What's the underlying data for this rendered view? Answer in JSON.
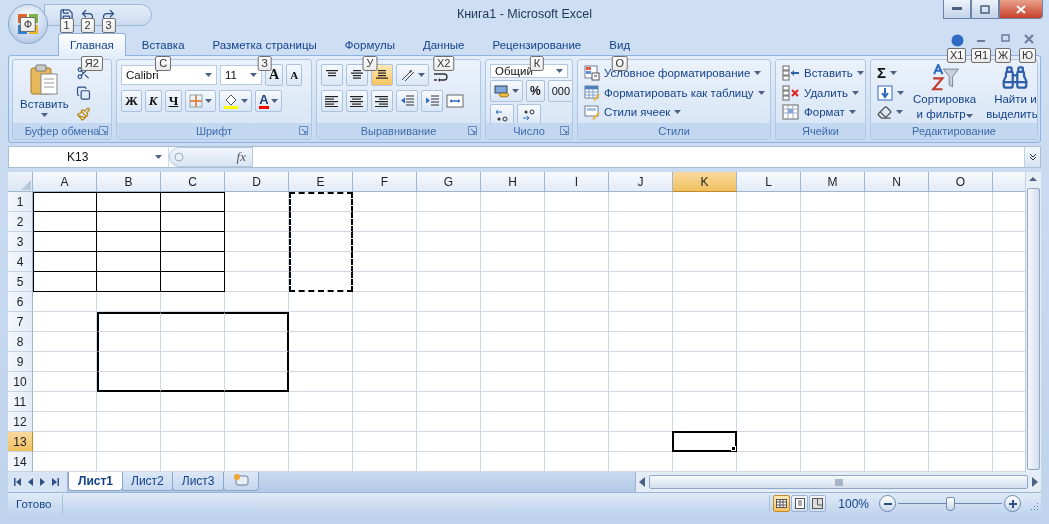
{
  "window": {
    "title": "Книга1 - Microsoft Excel"
  },
  "office_button": {
    "keytip": "Ф"
  },
  "quick_access": [
    {
      "kind": "save",
      "keytip": "1"
    },
    {
      "kind": "undo",
      "keytip": "2"
    },
    {
      "kind": "redo",
      "keytip": "3"
    }
  ],
  "tabs": [
    {
      "label": "Главная",
      "selected": true,
      "keytip": "Я2"
    },
    {
      "label": "Вставка",
      "selected": false,
      "keytip": "С"
    },
    {
      "label": "Разметка страницы",
      "selected": false,
      "keytip": "З"
    },
    {
      "label": "Формулы",
      "selected": false,
      "keytip": "У"
    },
    {
      "label": "Данные",
      "selected": false,
      "keytip": "Х2"
    },
    {
      "label": "Рецензирование",
      "selected": false,
      "keytip": "К"
    },
    {
      "label": "Вид",
      "selected": false,
      "keytip": "О"
    }
  ],
  "workbook_controls": [
    {
      "kind": "help",
      "keytip": "Х1"
    },
    {
      "kind": "minimize",
      "keytip": "Я1"
    },
    {
      "kind": "restore",
      "keytip": "Ж"
    },
    {
      "kind": "close",
      "keytip": "Ю"
    }
  ],
  "ribbon": {
    "clipboard": {
      "label": "Буфер обмена",
      "launcher": true,
      "paste": "Вставить"
    },
    "font": {
      "label": "Шрифт",
      "launcher": true,
      "font_name": "Calibri",
      "font_size": "11",
      "grow": "A",
      "shrink": "A",
      "bold": "Ж",
      "italic": "К",
      "underline": "Ч",
      "font_color": "A"
    },
    "alignment": {
      "label": "Выравнивание",
      "launcher": true,
      "vertical": [
        {
          "kind": "top",
          "selected": false
        },
        {
          "kind": "middle",
          "selected": false
        },
        {
          "kind": "bottom",
          "selected": true
        }
      ],
      "horizontal": [
        {
          "kind": "left",
          "selected": false
        },
        {
          "kind": "center",
          "selected": false
        },
        {
          "kind": "right",
          "selected": false
        }
      ]
    },
    "number": {
      "label": "Число",
      "launcher": true,
      "format": "Общий",
      "percent": "%",
      "thousands": "000"
    },
    "styles": {
      "label": "Стили",
      "launcher": false,
      "items": [
        {
          "kind": "conditional",
          "label": "Условное форматирование"
        },
        {
          "kind": "table",
          "label": "Форматировать как таблицу"
        },
        {
          "kind": "cell-styles",
          "label": "Стили ячеек"
        }
      ]
    },
    "cells": {
      "label": "Ячейки",
      "launcher": false,
      "items": [
        {
          "kind": "insert",
          "label": "Вставить"
        },
        {
          "kind": "delete",
          "label": "Удалить"
        },
        {
          "kind": "format",
          "label": "Формат"
        }
      ]
    },
    "editing": {
      "label": "Редактирование",
      "launcher": false,
      "autosum": "Σ",
      "sort": [
        "Сортировка",
        "и фильтр"
      ],
      "find": [
        "Найти и",
        "выделить"
      ]
    }
  },
  "formula_bar": {
    "name_box": "K13",
    "function_label": "fx"
  },
  "columns": [
    {
      "label": "A",
      "selected": false
    },
    {
      "label": "B",
      "selected": false
    },
    {
      "label": "C",
      "selected": false
    },
    {
      "label": "D",
      "selected": false
    },
    {
      "label": "E",
      "selected": false
    },
    {
      "label": "F",
      "selected": false
    },
    {
      "label": "G",
      "selected": false
    },
    {
      "label": "H",
      "selected": false
    },
    {
      "label": "I",
      "selected": false
    },
    {
      "label": "J",
      "selected": false
    },
    {
      "label": "K",
      "selected": true
    },
    {
      "label": "L",
      "selected": false
    },
    {
      "label": "M",
      "selected": false
    },
    {
      "label": "N",
      "selected": false
    },
    {
      "label": "O",
      "selected": false
    }
  ],
  "rows": [
    {
      "label": "1",
      "selected": false,
      "cells": [
        {
          "kind": "thin"
        },
        {
          "kind": "thin"
        },
        {
          "kind": "thin"
        },
        {
          "kind": "plain"
        },
        {
          "kind": "marquee"
        },
        {
          "kind": "plain"
        },
        {
          "kind": "plain"
        },
        {
          "kind": "plain"
        },
        {
          "kind": "plain"
        },
        {
          "kind": "plain"
        },
        {
          "kind": "plain"
        },
        {
          "kind": "plain"
        },
        {
          "kind": "plain"
        },
        {
          "kind": "plain"
        },
        {
          "kind": "plain"
        }
      ]
    },
    {
      "label": "2",
      "selected": false,
      "cells": [
        {
          "kind": "thin"
        },
        {
          "kind": "thin"
        },
        {
          "kind": "thin"
        },
        {
          "kind": "plain"
        },
        {
          "kind": "marquee"
        },
        {
          "kind": "plain"
        },
        {
          "kind": "plain"
        },
        {
          "kind": "plain"
        },
        {
          "kind": "plain"
        },
        {
          "kind": "plain"
        },
        {
          "kind": "plain"
        },
        {
          "kind": "plain"
        },
        {
          "kind": "plain"
        },
        {
          "kind": "plain"
        },
        {
          "kind": "plain"
        }
      ]
    },
    {
      "label": "3",
      "selected": false,
      "cells": [
        {
          "kind": "thin"
        },
        {
          "kind": "thin"
        },
        {
          "kind": "thin"
        },
        {
          "kind": "plain"
        },
        {
          "kind": "marquee"
        },
        {
          "kind": "plain"
        },
        {
          "kind": "plain"
        },
        {
          "kind": "plain"
        },
        {
          "kind": "plain"
        },
        {
          "kind": "plain"
        },
        {
          "kind": "plain"
        },
        {
          "kind": "plain"
        },
        {
          "kind": "plain"
        },
        {
          "kind": "plain"
        },
        {
          "kind": "plain"
        }
      ]
    },
    {
      "label": "4",
      "selected": false,
      "cells": [
        {
          "kind": "thin"
        },
        {
          "kind": "thin"
        },
        {
          "kind": "thin"
        },
        {
          "kind": "plain"
        },
        {
          "kind": "marquee"
        },
        {
          "kind": "plain"
        },
        {
          "kind": "plain"
        },
        {
          "kind": "plain"
        },
        {
          "kind": "plain"
        },
        {
          "kind": "plain"
        },
        {
          "kind": "plain"
        },
        {
          "kind": "plain"
        },
        {
          "kind": "plain"
        },
        {
          "kind": "plain"
        },
        {
          "kind": "plain"
        }
      ]
    },
    {
      "label": "5",
      "selected": false,
      "cells": [
        {
          "kind": "thin"
        },
        {
          "kind": "thin"
        },
        {
          "kind": "thin"
        },
        {
          "kind": "plain"
        },
        {
          "kind": "marquee"
        },
        {
          "kind": "plain"
        },
        {
          "kind": "plain"
        },
        {
          "kind": "plain"
        },
        {
          "kind": "plain"
        },
        {
          "kind": "plain"
        },
        {
          "kind": "plain"
        },
        {
          "kind": "plain"
        },
        {
          "kind": "plain"
        },
        {
          "kind": "plain"
        },
        {
          "kind": "plain"
        }
      ]
    },
    {
      "label": "6",
      "selected": false,
      "cells": [
        {
          "kind": "plain"
        },
        {
          "kind": "plain"
        },
        {
          "kind": "plain"
        },
        {
          "kind": "plain"
        },
        {
          "kind": "plain"
        },
        {
          "kind": "plain"
        },
        {
          "kind": "plain"
        },
        {
          "kind": "plain"
        },
        {
          "kind": "plain"
        },
        {
          "kind": "plain"
        },
        {
          "kind": "plain"
        },
        {
          "kind": "plain"
        },
        {
          "kind": "plain"
        },
        {
          "kind": "plain"
        },
        {
          "kind": "plain"
        }
      ]
    },
    {
      "label": "7",
      "selected": false,
      "cells": [
        {
          "kind": "plain"
        },
        {
          "kind": "thick"
        },
        {
          "kind": "thick"
        },
        {
          "kind": "thick"
        },
        {
          "kind": "plain"
        },
        {
          "kind": "plain"
        },
        {
          "kind": "plain"
        },
        {
          "kind": "plain"
        },
        {
          "kind": "plain"
        },
        {
          "kind": "plain"
        },
        {
          "kind": "plain"
        },
        {
          "kind": "plain"
        },
        {
          "kind": "plain"
        },
        {
          "kind": "plain"
        },
        {
          "kind": "plain"
        }
      ]
    },
    {
      "label": "8",
      "selected": false,
      "cells": [
        {
          "kind": "plain"
        },
        {
          "kind": "thick"
        },
        {
          "kind": "thick"
        },
        {
          "kind": "thick"
        },
        {
          "kind": "plain"
        },
        {
          "kind": "plain"
        },
        {
          "kind": "plain"
        },
        {
          "kind": "plain"
        },
        {
          "kind": "plain"
        },
        {
          "kind": "plain"
        },
        {
          "kind": "plain"
        },
        {
          "kind": "plain"
        },
        {
          "kind": "plain"
        },
        {
          "kind": "plain"
        },
        {
          "kind": "plain"
        }
      ]
    },
    {
      "label": "9",
      "selected": false,
      "cells": [
        {
          "kind": "plain"
        },
        {
          "kind": "thick"
        },
        {
          "kind": "thick"
        },
        {
          "kind": "thick"
        },
        {
          "kind": "plain"
        },
        {
          "kind": "plain"
        },
        {
          "kind": "plain"
        },
        {
          "kind": "plain"
        },
        {
          "kind": "plain"
        },
        {
          "kind": "plain"
        },
        {
          "kind": "plain"
        },
        {
          "kind": "plain"
        },
        {
          "kind": "plain"
        },
        {
          "kind": "plain"
        },
        {
          "kind": "plain"
        }
      ]
    },
    {
      "label": "10",
      "selected": false,
      "cells": [
        {
          "kind": "plain"
        },
        {
          "kind": "thick"
        },
        {
          "kind": "thick"
        },
        {
          "kind": "thick"
        },
        {
          "kind": "plain"
        },
        {
          "kind": "plain"
        },
        {
          "kind": "plain"
        },
        {
          "kind": "plain"
        },
        {
          "kind": "plain"
        },
        {
          "kind": "plain"
        },
        {
          "kind": "plain"
        },
        {
          "kind": "plain"
        },
        {
          "kind": "plain"
        },
        {
          "kind": "plain"
        },
        {
          "kind": "plain"
        }
      ]
    },
    {
      "label": "11",
      "selected": false,
      "cells": [
        {
          "kind": "plain"
        },
        {
          "kind": "plain"
        },
        {
          "kind": "plain"
        },
        {
          "kind": "plain"
        },
        {
          "kind": "plain"
        },
        {
          "kind": "plain"
        },
        {
          "kind": "plain"
        },
        {
          "kind": "plain"
        },
        {
          "kind": "plain"
        },
        {
          "kind": "plain"
        },
        {
          "kind": "plain"
        },
        {
          "kind": "plain"
        },
        {
          "kind": "plain"
        },
        {
          "kind": "plain"
        },
        {
          "kind": "plain"
        }
      ]
    },
    {
      "label": "12",
      "selected": false,
      "cells": [
        {
          "kind": "plain"
        },
        {
          "kind": "plain"
        },
        {
          "kind": "plain"
        },
        {
          "kind": "plain"
        },
        {
          "kind": "plain"
        },
        {
          "kind": "plain"
        },
        {
          "kind": "plain"
        },
        {
          "kind": "plain"
        },
        {
          "kind": "plain"
        },
        {
          "kind": "plain"
        },
        {
          "kind": "plain"
        },
        {
          "kind": "plain"
        },
        {
          "kind": "plain"
        },
        {
          "kind": "plain"
        },
        {
          "kind": "plain"
        }
      ]
    },
    {
      "label": "13",
      "selected": true,
      "cells": [
        {
          "kind": "plain"
        },
        {
          "kind": "plain"
        },
        {
          "kind": "plain"
        },
        {
          "kind": "plain"
        },
        {
          "kind": "plain"
        },
        {
          "kind": "plain"
        },
        {
          "kind": "plain"
        },
        {
          "kind": "plain"
        },
        {
          "kind": "plain"
        },
        {
          "kind": "plain"
        },
        {
          "kind": "plain"
        },
        {
          "kind": "plain"
        },
        {
          "kind": "plain"
        },
        {
          "kind": "plain"
        },
        {
          "kind": "plain"
        }
      ]
    },
    {
      "label": "14",
      "selected": false,
      "cells": [
        {
          "kind": "plain"
        },
        {
          "kind": "plain"
        },
        {
          "kind": "plain"
        },
        {
          "kind": "plain"
        },
        {
          "kind": "plain"
        },
        {
          "kind": "plain"
        },
        {
          "kind": "plain"
        },
        {
          "kind": "plain"
        },
        {
          "kind": "plain"
        },
        {
          "kind": "plain"
        },
        {
          "kind": "plain"
        },
        {
          "kind": "plain"
        },
        {
          "kind": "plain"
        },
        {
          "kind": "plain"
        },
        {
          "kind": "plain"
        }
      ]
    }
  ],
  "sheets": [
    {
      "label": "Лист1",
      "selected": true
    },
    {
      "label": "Лист2",
      "selected": false
    },
    {
      "label": "Лист3",
      "selected": false
    }
  ],
  "status_bar": {
    "text": "Готово",
    "views": [
      {
        "kind": "normal",
        "selected": true
      },
      {
        "kind": "page-layout",
        "selected": false
      },
      {
        "kind": "page-break",
        "selected": false
      }
    ],
    "zoom": "100%",
    "zoom_slider": {
      "level": 0.5
    }
  }
}
